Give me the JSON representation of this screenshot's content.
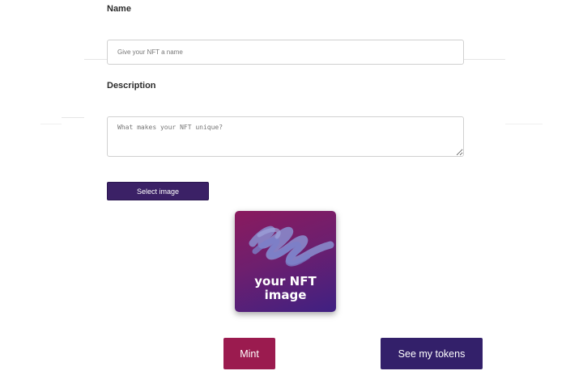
{
  "form": {
    "name_label": "Name",
    "name_placeholder": "Give your NFT a name",
    "description_label": "Description",
    "description_placeholder": "What makes your NFT unique?",
    "select_image_label": "Select image"
  },
  "preview": {
    "line1": "your NFT",
    "line2": "image"
  },
  "actions": {
    "mint_label": "Mint",
    "tokens_label": "See my tokens"
  },
  "colors": {
    "primary": "#3b2166",
    "mint": "#9b1b4f",
    "tokens": "#33206a"
  }
}
